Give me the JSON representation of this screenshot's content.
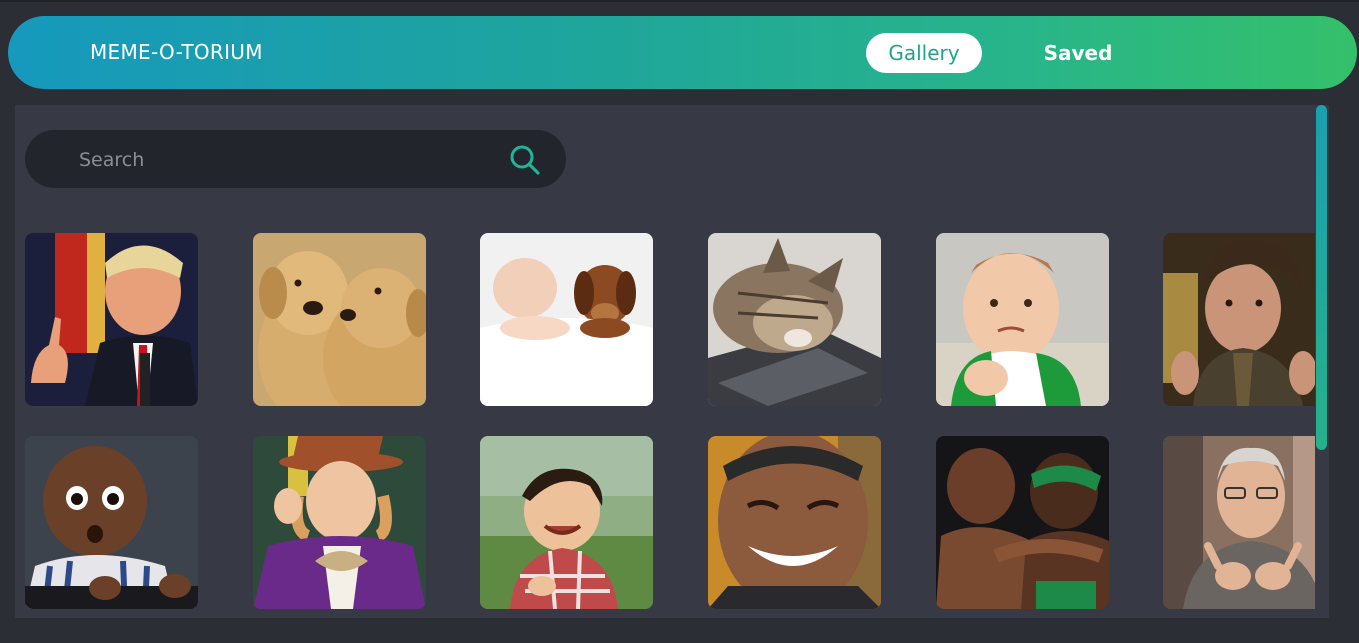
{
  "app": {
    "title": "MEME-O-TORIUM"
  },
  "nav": {
    "gallery": "Gallery",
    "saved": "Saved",
    "active": "Gallery"
  },
  "search": {
    "placeholder": "Search",
    "value": "",
    "icon": "search-icon"
  },
  "colors": {
    "accent": "#1fa68a",
    "header_gradient_start": "#1699bd",
    "header_gradient_end": "#34c06a",
    "panel": "#373a44",
    "background": "#2b2e35"
  },
  "gallery": {
    "images": [
      {
        "subject": "man in suit pointing finger",
        "icon": "meme-image"
      },
      {
        "subject": "two labrador puppies kissing",
        "icon": "meme-image"
      },
      {
        "subject": "sleeping baby and puppy under blanket",
        "icon": "meme-image"
      },
      {
        "subject": "cat sleeping on laptop keyboard",
        "icon": "meme-image"
      },
      {
        "subject": "success kid fist on beach",
        "icon": "meme-image"
      },
      {
        "subject": "man with wild hair gesturing",
        "icon": "meme-image"
      },
      {
        "subject": "surprised baby in striped shirt",
        "icon": "meme-image"
      },
      {
        "subject": "man in purple coat and top hat",
        "icon": "meme-image"
      },
      {
        "subject": "laughing toddler in plaid shirt",
        "icon": "meme-image"
      },
      {
        "subject": "man laughing with eyes closed",
        "icon": "meme-image"
      },
      {
        "subject": "two basketball players close together",
        "icon": "meme-image"
      },
      {
        "subject": "man pointing with both hands",
        "icon": "meme-image"
      }
    ]
  }
}
